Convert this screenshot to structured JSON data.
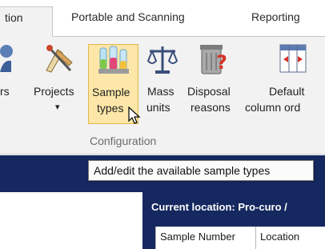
{
  "tabs": {
    "active": "tion",
    "portable": "Portable and Scanning",
    "reporting": "Reporting"
  },
  "ribbon": {
    "buttons": {
      "users": {
        "line1": "rs",
        "line2": "",
        "icon": "users-icon"
      },
      "projects": {
        "line1": "Projects",
        "line2": "▾",
        "icon": "projects-icon"
      },
      "sample_types": {
        "line1": "Sample",
        "line2": "types",
        "icon": "flasks-icon"
      },
      "mass_units": {
        "line1": "Mass",
        "line2": "units",
        "icon": "scales-icon"
      },
      "disposal_reasons": {
        "line1": "Disposal",
        "line2": "reasons",
        "icon": "bin-icon"
      },
      "default_column_order": {
        "line1": "Default",
        "line2": "column ord",
        "icon": "columns-icon"
      }
    },
    "group_label": "Configuration"
  },
  "tooltip": "Add/edit the available sample types",
  "location": {
    "current": "Current location: Pro-curo /"
  },
  "grid": {
    "columns": [
      "Sample Number",
      "Location"
    ]
  },
  "colors": {
    "ribbon_bg": "#f2f2f2",
    "dark_band": "#15285f",
    "highlight": "#fde7a8"
  }
}
